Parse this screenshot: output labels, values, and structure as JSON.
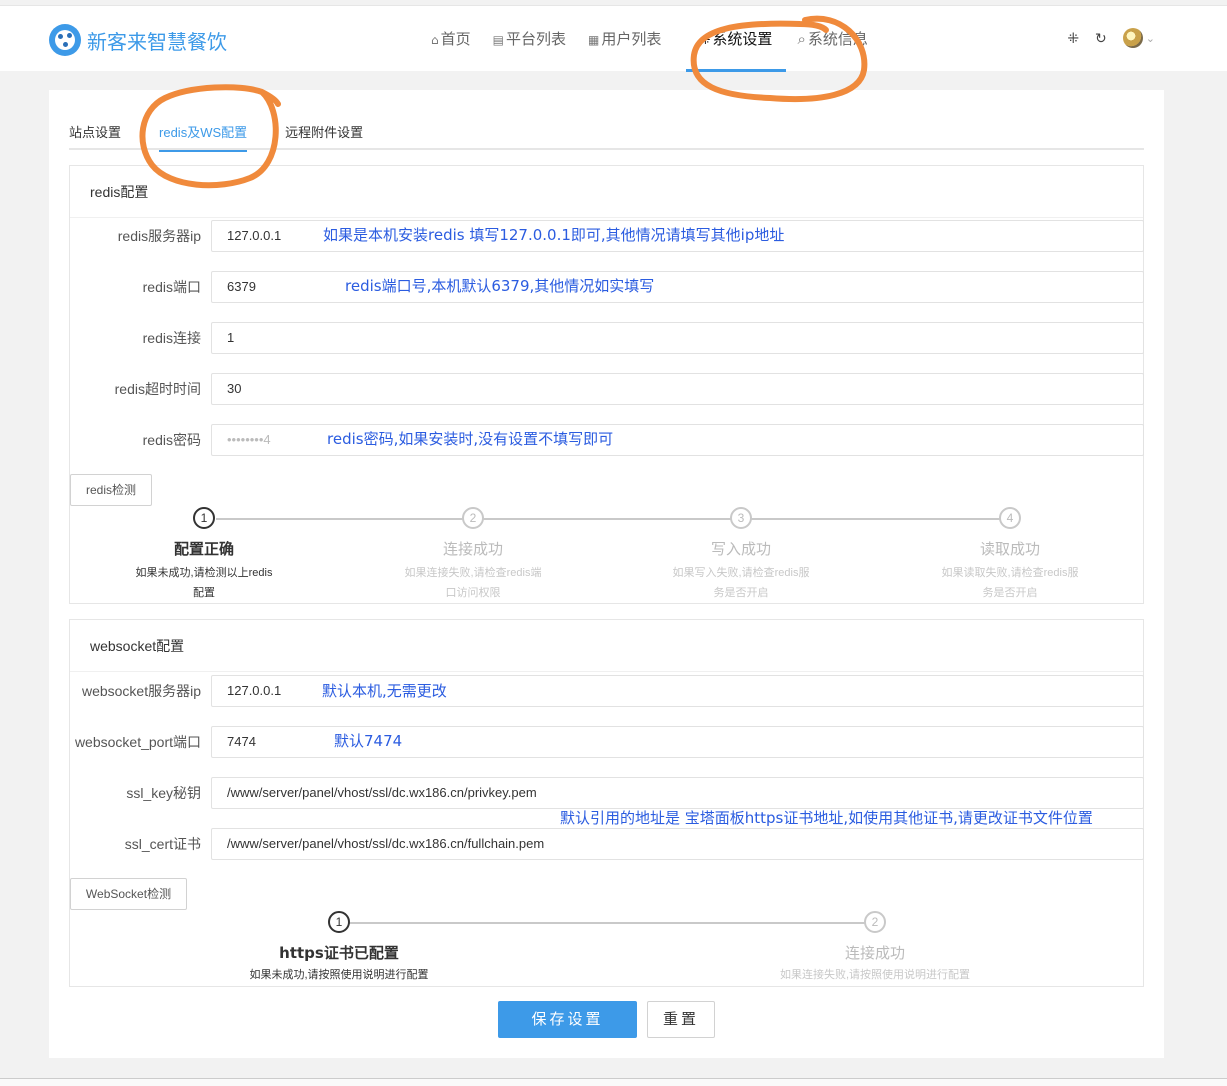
{
  "app": {
    "logo_text": "新客来智慧餐饮"
  },
  "nav": {
    "items": [
      {
        "icon": "home-icon",
        "glyph": "⌂",
        "label": "首页"
      },
      {
        "icon": "server-icon",
        "glyph": "▤",
        "label": "平台列表"
      },
      {
        "icon": "image-icon",
        "glyph": "▦",
        "label": "用户列表"
      },
      {
        "icon": "grid-icon",
        "glyph": "⁜",
        "label": "系统设置",
        "active": true
      },
      {
        "icon": "search-icon",
        "glyph": "⌕",
        "label": "系统信息"
      }
    ],
    "right": {
      "apps_glyph": "⁜",
      "refresh_glyph": "↻",
      "chevron_glyph": "⌄"
    }
  },
  "tabs": [
    {
      "label": "站点设置"
    },
    {
      "label": "redis及WS配置",
      "active": true
    },
    {
      "label": "远程附件设置"
    }
  ],
  "redis": {
    "title": "redis配置",
    "fields": [
      {
        "label": "redis服务器ip",
        "value": "127.0.0.1",
        "note": "如果是本机安装redis 填写127.0.0.1即可,其他情况请填写其他ip地址"
      },
      {
        "label": "redis端口",
        "value": "6379",
        "note": "redis端口号,本机默认6379,其他情况如实填写"
      },
      {
        "label": "redis连接",
        "value": "1",
        "note": ""
      },
      {
        "label": "redis超时时间",
        "value": "30",
        "note": ""
      },
      {
        "label": "redis密码",
        "value": "••••••••4",
        "note": "redis密码,如果安装时,没有设置不填写即可"
      }
    ],
    "check_button": "redis检测",
    "steps": [
      {
        "num": "1",
        "title": "配置正确",
        "desc": [
          "如果未成功,请检测以上redis",
          "配置"
        ],
        "active": true
      },
      {
        "num": "2",
        "title": "连接成功",
        "desc": [
          "如果连接失败,请检查redis端",
          "口访问权限"
        ],
        "active": false
      },
      {
        "num": "3",
        "title": "写入成功",
        "desc": [
          "如果写入失败,请检查redis服",
          "务是否开启"
        ],
        "active": false
      },
      {
        "num": "4",
        "title": "读取成功",
        "desc": [
          "如果读取失败,请检查redis服",
          "务是否开启"
        ],
        "active": false
      }
    ]
  },
  "websocket": {
    "title": "websocket配置",
    "fields": [
      {
        "label": "websocket服务器ip",
        "value": "127.0.0.1",
        "note": "默认本机,无需更改"
      },
      {
        "label": "websocket_port端口",
        "value": "7474",
        "note": "默认7474"
      },
      {
        "label": "ssl_key秘钥",
        "value": "/www/server/panel/vhost/ssl/dc.wx186.cn/privkey.pem",
        "note": ""
      },
      {
        "label": "ssl_cert证书",
        "value": "/www/server/panel/vhost/ssl/dc.wx186.cn/fullchain.pem",
        "note": ""
      }
    ],
    "cert_note": "默认引用的地址是 宝塔面板https证书地址,如使用其他证书,请更改证书文件位置",
    "check_button": "WebSocket检测",
    "steps": [
      {
        "num": "1",
        "title": "https证书已配置",
        "desc": [
          "如果未成功,请按照使用说明进行配置"
        ],
        "active": true
      },
      {
        "num": "2",
        "title": "连接成功",
        "desc": [
          "如果连接失败,请按照使用说明进行配置"
        ],
        "active": false
      }
    ]
  },
  "actions": {
    "save": "保存设置",
    "reset": "重置"
  }
}
